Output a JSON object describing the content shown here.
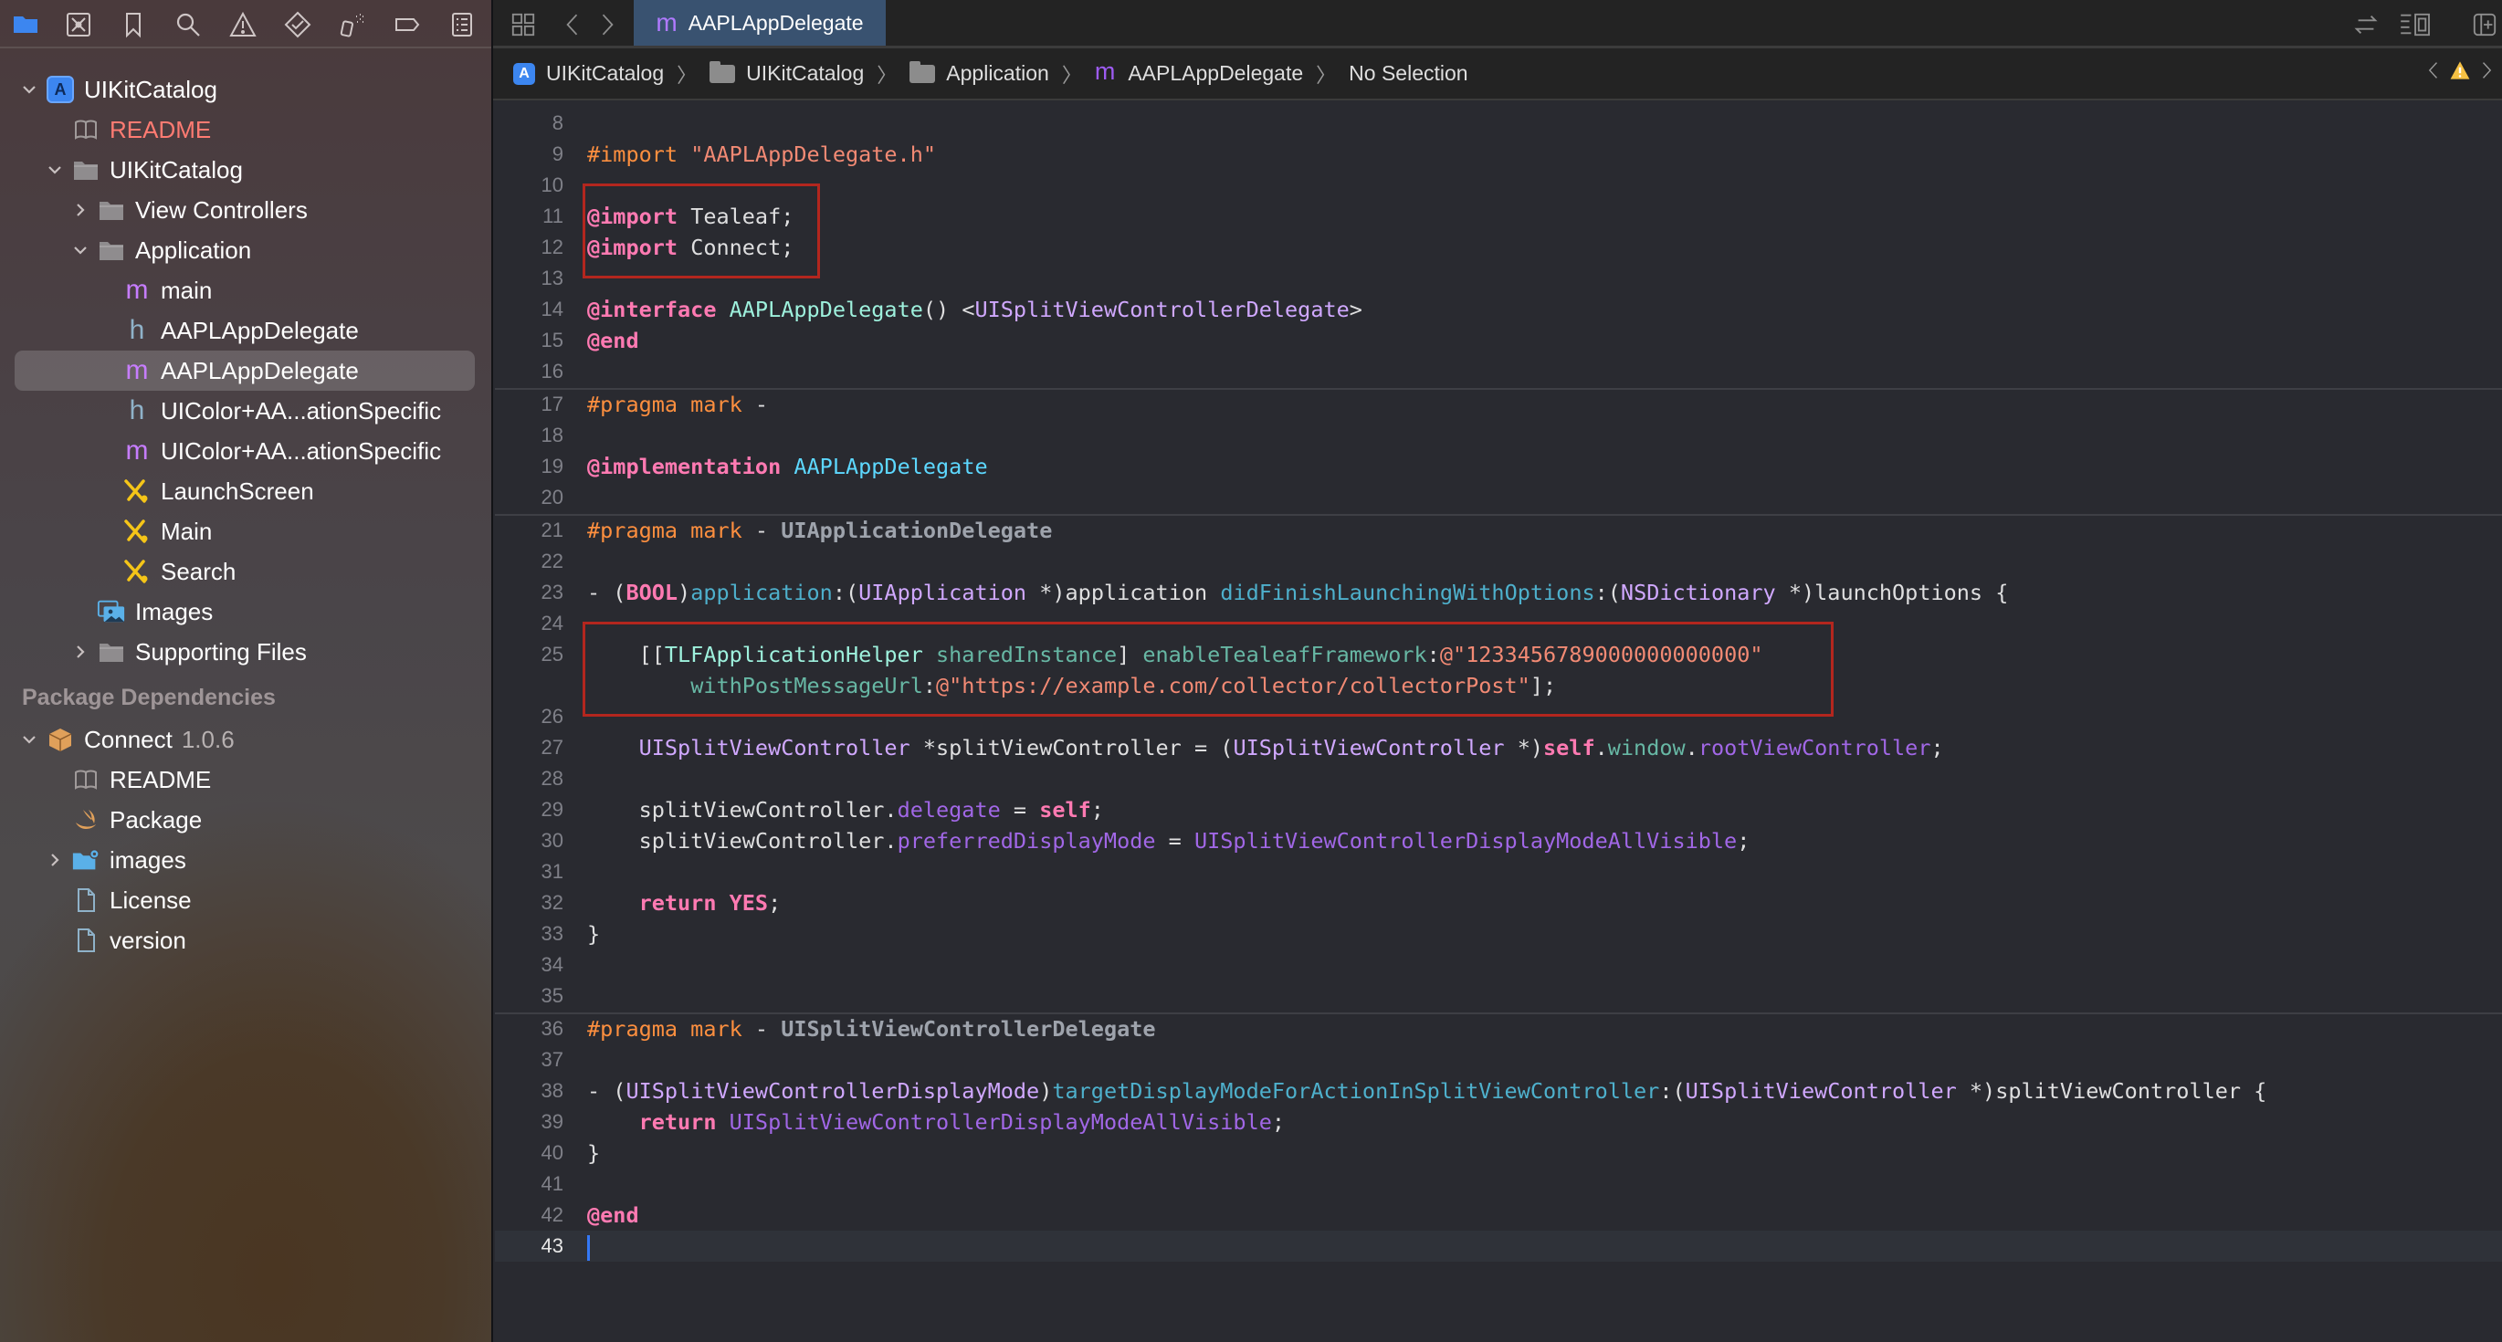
{
  "navigator_toolbar": {
    "icons": [
      "folder-icon",
      "source-control-icon",
      "bookmark-icon",
      "search-icon",
      "warning-icon",
      "test-icon",
      "debug-icon",
      "breakpoint-icon",
      "report-icon"
    ]
  },
  "editor_toolbar": {
    "active_tab": {
      "icon": "m",
      "label": "AAPLAppDelegate"
    },
    "right_icons": [
      "swap-icon",
      "inspector-layout-icon",
      "add-editor-icon"
    ]
  },
  "breadcrumb": {
    "items": [
      {
        "icon": "app-icon",
        "label": "UIKitCatalog"
      },
      {
        "icon": "folder-icon",
        "label": "UIKitCatalog"
      },
      {
        "icon": "folder-icon",
        "label": "Application"
      },
      {
        "icon": "m",
        "label": "AAPLAppDelegate"
      },
      {
        "icon": "",
        "label": "No Selection"
      }
    ],
    "issue_nav": {
      "status": "warning"
    }
  },
  "sidebar": {
    "tree": [
      {
        "label": "UIKitCatalog",
        "icon": "app-project-icon",
        "depth": 0,
        "disclosure": "open"
      },
      {
        "label": "README",
        "icon": "book-icon",
        "depth": 1,
        "disclosure": "none",
        "color": "#ff7b72"
      },
      {
        "label": "UIKitCatalog",
        "icon": "folder-icon",
        "depth": 1,
        "disclosure": "open"
      },
      {
        "label": "View Controllers",
        "icon": "folder-icon",
        "depth": 2,
        "disclosure": "closed"
      },
      {
        "label": "Application",
        "icon": "folder-icon",
        "depth": 2,
        "disclosure": "open"
      },
      {
        "label": "main",
        "icon": "m",
        "depth": 3,
        "disclosure": "none"
      },
      {
        "label": "AAPLAppDelegate",
        "icon": "h",
        "depth": 3,
        "disclosure": "none"
      },
      {
        "label": "AAPLAppDelegate",
        "icon": "m",
        "depth": 3,
        "disclosure": "none",
        "selected": true
      },
      {
        "label": "UIColor+AA...ationSpecific",
        "icon": "h",
        "depth": 3,
        "disclosure": "none"
      },
      {
        "label": "UIColor+AA...ationSpecific",
        "icon": "m",
        "depth": 3,
        "disclosure": "none"
      },
      {
        "label": "LaunchScreen",
        "icon": "storyboard",
        "depth": 3,
        "disclosure": "none"
      },
      {
        "label": "Main",
        "icon": "storyboard",
        "depth": 3,
        "disclosure": "none"
      },
      {
        "label": "Search",
        "icon": "storyboard",
        "depth": 3,
        "disclosure": "none"
      },
      {
        "label": "Images",
        "icon": "assets",
        "depth": 2,
        "disclosure": "none"
      },
      {
        "label": "Supporting Files",
        "icon": "folder-icon",
        "depth": 2,
        "disclosure": "closed"
      }
    ],
    "package_header": "Package Dependencies",
    "package": {
      "name": "Connect",
      "version": "1.0.6"
    },
    "package_tree": [
      {
        "label": "README",
        "icon": "book-icon",
        "depth": 1,
        "disclosure": "none"
      },
      {
        "label": "Package",
        "icon": "swift",
        "depth": 1,
        "disclosure": "none"
      },
      {
        "label": "images",
        "icon": "folder-gear",
        "depth": 1,
        "disclosure": "closed"
      },
      {
        "label": "License",
        "icon": "doc",
        "depth": 1,
        "disclosure": "none"
      },
      {
        "label": "version",
        "icon": "doc",
        "depth": 1,
        "disclosure": "none"
      }
    ]
  },
  "editor": {
    "current_line": 43,
    "lines": [
      {
        "n": "8",
        "tokens": []
      },
      {
        "n": "9",
        "tokens": [
          [
            "pp",
            "#import "
          ],
          [
            "str2",
            "\"AAPLAppDelegate.h\""
          ]
        ]
      },
      {
        "n": "10",
        "tokens": []
      },
      {
        "n": "11",
        "tokens": [
          [
            "kw",
            "@import"
          ],
          [
            "plain",
            " Tealeaf;"
          ]
        ]
      },
      {
        "n": "12",
        "tokens": [
          [
            "kw",
            "@import"
          ],
          [
            "plain",
            " Connect;"
          ]
        ]
      },
      {
        "n": "13",
        "tokens": []
      },
      {
        "n": "14",
        "tokens": [
          [
            "kw",
            "@interface"
          ],
          [
            "plain",
            " "
          ],
          [
            "cls",
            "AAPLAppDelegate"
          ],
          [
            "plain",
            "() <"
          ],
          [
            "typ",
            "UISplitViewControllerDelegate"
          ],
          [
            "plain",
            ">"
          ]
        ]
      },
      {
        "n": "15",
        "tokens": [
          [
            "kw",
            "@end"
          ]
        ]
      },
      {
        "n": "16",
        "tokens": [],
        "sep_after": true
      },
      {
        "n": "17",
        "tokens": [
          [
            "pp",
            "#pragma mark"
          ],
          [
            "plain",
            " -"
          ]
        ]
      },
      {
        "n": "18",
        "tokens": []
      },
      {
        "n": "19",
        "tokens": [
          [
            "kw",
            "@implementation"
          ],
          [
            "plain",
            " "
          ],
          [
            "cls2",
            "AAPLAppDelegate"
          ]
        ]
      },
      {
        "n": "20",
        "tokens": [],
        "sep_after": true
      },
      {
        "n": "21",
        "tokens": [
          [
            "pp",
            "#pragma mark"
          ],
          [
            "plain",
            " - "
          ],
          [
            "mark",
            "UIApplicationDelegate"
          ]
        ]
      },
      {
        "n": "22",
        "tokens": []
      },
      {
        "n": "23",
        "tokens": [
          [
            "plain",
            "- ("
          ],
          [
            "kw",
            "BOOL"
          ],
          [
            "plain",
            ")"
          ],
          [
            "fn",
            "application"
          ],
          [
            "plain",
            ":("
          ],
          [
            "typ",
            "UIApplication"
          ],
          [
            "plain",
            " *)application "
          ],
          [
            "fn",
            "didFinishLaunchingWithOptions"
          ],
          [
            "plain",
            ":("
          ],
          [
            "typ",
            "NSDictionary"
          ],
          [
            "plain",
            " *)launchOptions {"
          ]
        ]
      },
      {
        "n": "24",
        "tokens": []
      },
      {
        "n": "25",
        "tokens": [
          [
            "plain",
            "    [["
          ],
          [
            "cls",
            "TLFApplicationHelper"
          ],
          [
            "plain",
            " "
          ],
          [
            "meth",
            "sharedInstance"
          ],
          [
            "plain",
            "] "
          ],
          [
            "meth",
            "enableTealeafFramework"
          ],
          [
            "plain",
            ":"
          ],
          [
            "str2",
            "@\"1233456789000000000000\""
          ]
        ]
      },
      {
        "n": "",
        "tokens": [
          [
            "plain",
            "        "
          ],
          [
            "meth",
            "withPostMessageUrl"
          ],
          [
            "plain",
            ":"
          ],
          [
            "str2",
            "@\"https://example.com/collector/collectorPost\""
          ],
          [
            "plain",
            "];"
          ]
        ]
      },
      {
        "n": "26",
        "tokens": []
      },
      {
        "n": "27",
        "tokens": [
          [
            "plain",
            "    "
          ],
          [
            "typ",
            "UISplitViewController"
          ],
          [
            "plain",
            " *splitViewController = ("
          ],
          [
            "typ",
            "UISplitViewController"
          ],
          [
            "plain",
            " *)"
          ],
          [
            "kw",
            "self"
          ],
          [
            "plain",
            "."
          ],
          [
            "meth",
            "window"
          ],
          [
            "plain",
            "."
          ],
          [
            "prop",
            "rootViewController"
          ],
          [
            "plain",
            ";"
          ]
        ]
      },
      {
        "n": "28",
        "tokens": []
      },
      {
        "n": "29",
        "tokens": [
          [
            "plain",
            "    splitViewController."
          ],
          [
            "prop",
            "delegate"
          ],
          [
            "plain",
            " = "
          ],
          [
            "kw",
            "self"
          ],
          [
            "plain",
            ";"
          ]
        ]
      },
      {
        "n": "30",
        "tokens": [
          [
            "plain",
            "    splitViewController."
          ],
          [
            "prop",
            "preferredDisplayMode"
          ],
          [
            "plain",
            " = "
          ],
          [
            "prop",
            "UISplitViewControllerDisplayModeAllVisible"
          ],
          [
            "plain",
            ";"
          ]
        ]
      },
      {
        "n": "31",
        "tokens": []
      },
      {
        "n": "32",
        "tokens": [
          [
            "plain",
            "    "
          ],
          [
            "kw",
            "return"
          ],
          [
            "plain",
            " "
          ],
          [
            "kw",
            "YES"
          ],
          [
            "plain",
            ";"
          ]
        ]
      },
      {
        "n": "33",
        "tokens": [
          [
            "plain",
            "}"
          ]
        ]
      },
      {
        "n": "34",
        "tokens": []
      },
      {
        "n": "35",
        "tokens": [],
        "sep_after": true
      },
      {
        "n": "36",
        "tokens": [
          [
            "pp",
            "#pragma mark"
          ],
          [
            "plain",
            " - "
          ],
          [
            "mark",
            "UISplitViewControllerDelegate"
          ]
        ]
      },
      {
        "n": "37",
        "tokens": []
      },
      {
        "n": "38",
        "tokens": [
          [
            "plain",
            "- ("
          ],
          [
            "typ",
            "UISplitViewControllerDisplayMode"
          ],
          [
            "plain",
            ")"
          ],
          [
            "fn",
            "targetDisplayModeForActionInSplitViewController"
          ],
          [
            "plain",
            ":("
          ],
          [
            "typ",
            "UISplitViewController"
          ],
          [
            "plain",
            " *)splitViewController {"
          ]
        ]
      },
      {
        "n": "39",
        "tokens": [
          [
            "plain",
            "    "
          ],
          [
            "kw",
            "return"
          ],
          [
            "plain",
            " "
          ],
          [
            "prop",
            "UISplitViewControllerDisplayModeAllVisible"
          ],
          [
            "plain",
            ";"
          ]
        ]
      },
      {
        "n": "40",
        "tokens": [
          [
            "plain",
            "}"
          ]
        ]
      },
      {
        "n": "41",
        "tokens": []
      },
      {
        "n": "42",
        "tokens": [
          [
            "kw",
            "@end"
          ]
        ]
      },
      {
        "n": "43",
        "tokens": [],
        "cursor": true
      }
    ],
    "highlight_boxes": [
      {
        "label": "import-highlight",
        "from_line": "10",
        "to_line": "13"
      },
      {
        "label": "tealeaf-init-highlight",
        "from_line": "24",
        "to_line": "26"
      }
    ]
  }
}
